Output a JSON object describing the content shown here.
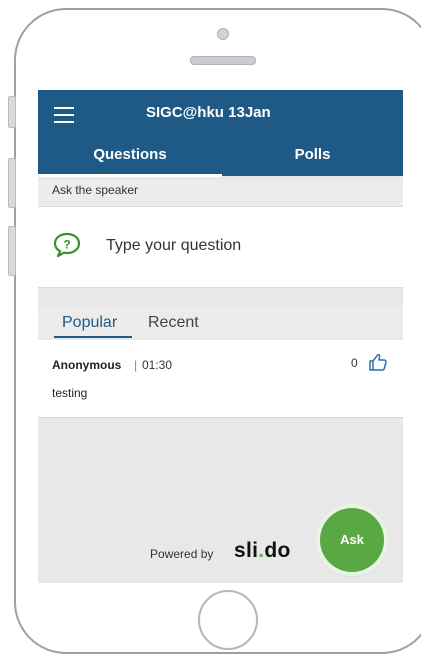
{
  "header": {
    "title": "SIGC@hku 13Jan",
    "tabs": [
      {
        "label": "Questions",
        "active": true
      },
      {
        "label": "Polls",
        "active": false
      }
    ]
  },
  "ask": {
    "section_label": "Ask the speaker",
    "placeholder": "Type your question",
    "icon": "question-bubble-icon"
  },
  "sort": {
    "tabs": [
      {
        "label": "Popular",
        "active": true
      },
      {
        "label": "Recent",
        "active": false
      }
    ]
  },
  "questions": [
    {
      "author": "Anonymous",
      "separator": "|",
      "time": "01:30",
      "votes": "0",
      "text": "testing"
    }
  ],
  "footer": {
    "powered_by": "Powered by",
    "brand": "slido",
    "brand_a": "sli",
    "brand_dot": ".",
    "brand_b": "do"
  },
  "ask_button": {
    "label": "Ask"
  },
  "colors": {
    "header": "#1e5a85",
    "accent_green": "#5aa843"
  }
}
